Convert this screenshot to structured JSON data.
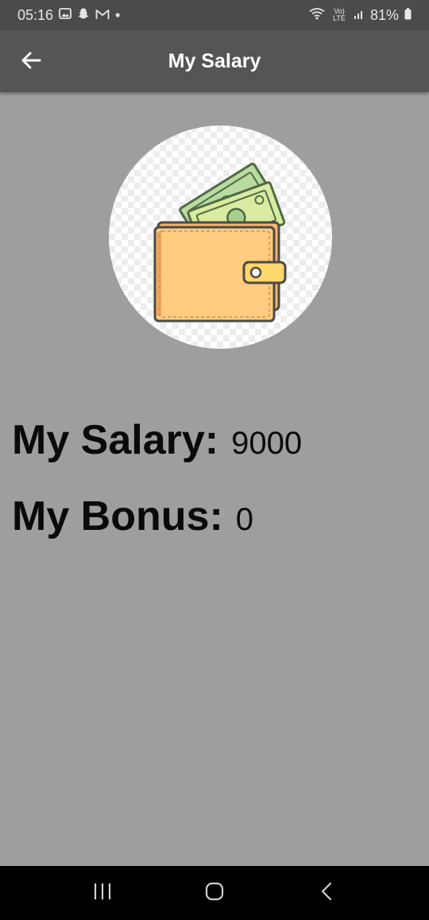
{
  "status_bar": {
    "time": "05:16",
    "battery": "81%",
    "network": "Vo) LTE",
    "dot": "•",
    "left_icons": [
      "gallery-icon",
      "snapchat-icon",
      "gmail-icon"
    ],
    "right_icons": [
      "wifi-icon",
      "signal-icon",
      "battery-icon"
    ]
  },
  "app_bar": {
    "title": "My Salary",
    "back_icon": "back-arrow-icon"
  },
  "avatar": {
    "image": "wallet-with-money-icon"
  },
  "salary": {
    "label": "My Salary:",
    "value": "9000"
  },
  "bonus": {
    "label": "My Bonus:",
    "value": "0"
  },
  "nav_bar": {
    "buttons": [
      "recents-icon",
      "home-icon",
      "back-icon"
    ]
  },
  "colors": {
    "status_bar": "#4b4b4b",
    "app_bar": "#555555",
    "background": "#9e9e9e",
    "nav_bar": "#000000",
    "wallet": "#ffcc80",
    "money": "#c5e1a5"
  }
}
